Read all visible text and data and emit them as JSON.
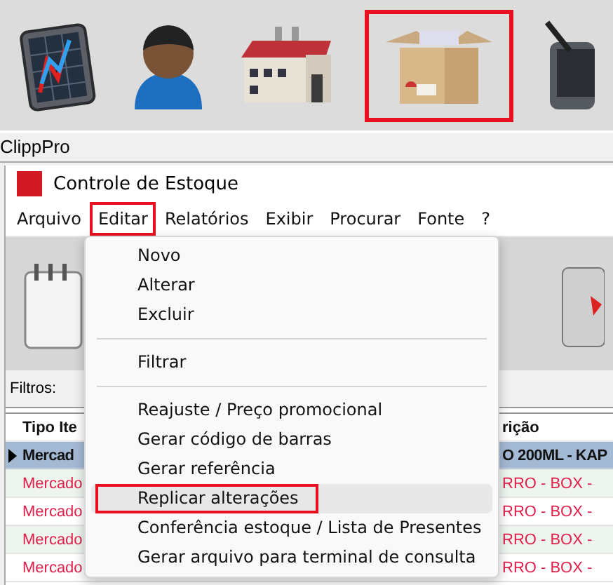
{
  "launcher": {
    "icons": [
      {
        "kind": "chart",
        "highlighted": false
      },
      {
        "kind": "person",
        "highlighted": false
      },
      {
        "kind": "factory",
        "highlighted": false
      },
      {
        "kind": "box",
        "highlighted": true
      },
      {
        "kind": "tablet",
        "highlighted": false
      }
    ]
  },
  "app_label": "ClippPro",
  "window": {
    "title": "Controle de Estoque"
  },
  "menubar": [
    {
      "label": "Arquivo",
      "highlighted": false
    },
    {
      "label": "Editar",
      "highlighted": true
    },
    {
      "label": "Relatórios",
      "highlighted": false
    },
    {
      "label": "Exibir",
      "highlighted": false
    },
    {
      "label": "Procurar",
      "highlighted": false
    },
    {
      "label": "Fonte",
      "highlighted": false
    },
    {
      "label": "?",
      "highlighted": false
    }
  ],
  "filters_label": "Filtros:",
  "table": {
    "columns": [
      "Tipo Ite",
      "rição"
    ],
    "rows": [
      {
        "cells": [
          "Mercad",
          "O 200ML - KAP"
        ],
        "selected": true
      },
      {
        "cells": [
          "Mercado",
          "RRO - BOX -"
        ],
        "selected": false
      },
      {
        "cells": [
          "Mercado",
          "RRO - BOX -"
        ],
        "selected": false
      },
      {
        "cells": [
          "Mercado",
          "RRO - BOX -"
        ],
        "selected": false
      },
      {
        "cells": [
          "Mercado",
          "RRO - BOX -"
        ],
        "selected": false
      }
    ]
  },
  "edit_menu": [
    {
      "kind": "item",
      "label": "Novo",
      "selected": false,
      "highlighted": false
    },
    {
      "kind": "item",
      "label": "Alterar",
      "selected": false,
      "highlighted": false
    },
    {
      "kind": "item",
      "label": "Excluir",
      "selected": false,
      "highlighted": false
    },
    {
      "kind": "separator"
    },
    {
      "kind": "item",
      "label": "Filtrar",
      "selected": false,
      "highlighted": false
    },
    {
      "kind": "separator"
    },
    {
      "kind": "item",
      "label": "Reajuste / Preço promocional",
      "selected": false,
      "highlighted": false
    },
    {
      "kind": "item",
      "label": "Gerar código de barras",
      "selected": false,
      "highlighted": false
    },
    {
      "kind": "item",
      "label": "Gerar referência",
      "selected": false,
      "highlighted": false
    },
    {
      "kind": "item",
      "label": "Replicar alterações",
      "selected": true,
      "highlighted": true
    },
    {
      "kind": "item",
      "label": "Conferência estoque / Lista de Presentes",
      "selected": false,
      "highlighted": false
    },
    {
      "kind": "item",
      "label": "Gerar arquivo para terminal de consulta",
      "selected": false,
      "highlighted": false
    }
  ]
}
